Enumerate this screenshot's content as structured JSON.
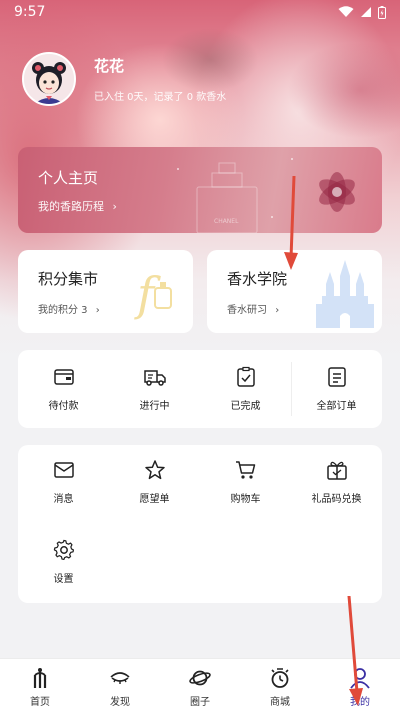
{
  "status_bar": {
    "time": "9:57"
  },
  "profile": {
    "name": "花花",
    "summary": "已入住 0天，记录了 0 款香水"
  },
  "cards": {
    "home": {
      "title": "个人主页",
      "subtitle": "我的香路历程"
    },
    "points": {
      "title": "积分集市",
      "subtitle": "我的积分 3"
    },
    "academy": {
      "title": "香水学院",
      "subtitle": "香水研习"
    }
  },
  "orders": [
    {
      "label": "待付款",
      "icon": "wallet-icon"
    },
    {
      "label": "进行中",
      "icon": "truck-icon"
    },
    {
      "label": "已完成",
      "icon": "clipboard-check-icon"
    },
    {
      "label": "全部订单",
      "icon": "list-icon"
    }
  ],
  "services": [
    {
      "label": "消息",
      "icon": "mail-icon"
    },
    {
      "label": "愿望单",
      "icon": "star-icon"
    },
    {
      "label": "购物车",
      "icon": "cart-icon"
    },
    {
      "label": "礼品码兑换",
      "icon": "gift-icon"
    },
    {
      "label": "设置",
      "icon": "gear-icon"
    }
  ],
  "tabs": [
    {
      "label": "首页",
      "icon": "home-icon"
    },
    {
      "label": "发现",
      "icon": "eye-icon"
    },
    {
      "label": "圈子",
      "icon": "planet-icon"
    },
    {
      "label": "商城",
      "icon": "shop-icon"
    },
    {
      "label": "我的",
      "icon": "profile-icon",
      "active": true
    }
  ],
  "colors": {
    "accent": "#3a2fa3",
    "hero_pink": "#d86478",
    "annotation_arrow": "#e04a3a"
  }
}
